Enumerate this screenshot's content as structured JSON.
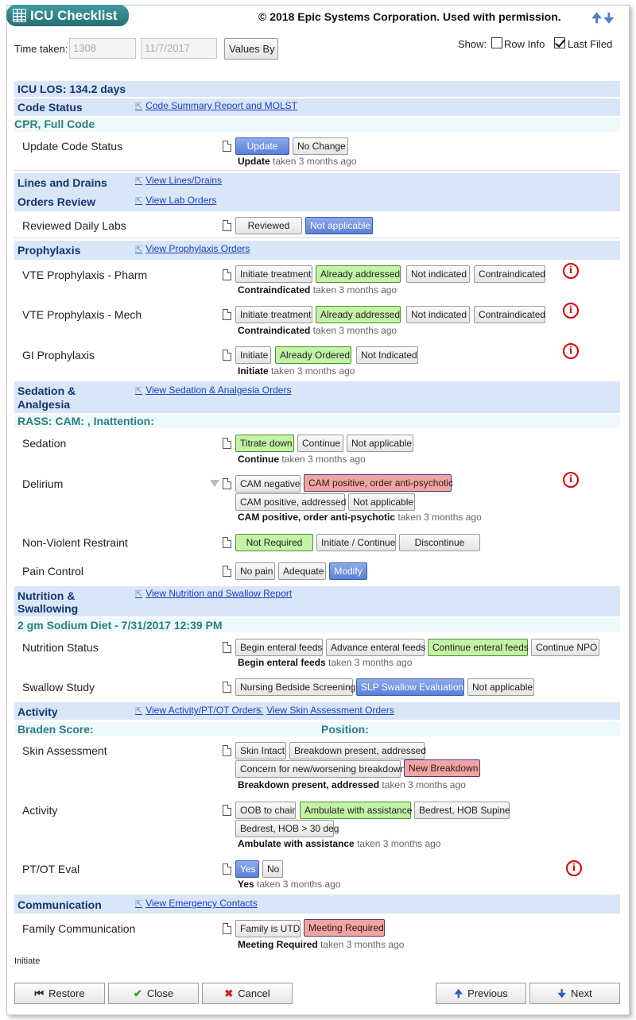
{
  "title": "ICU Checklist",
  "copyright": "© 2018 Epic Systems Corporation. Used with permission.",
  "header": {
    "time_taken_label": "Time taken:",
    "time": "1308",
    "date": "11/7/2017",
    "values_by": "Values By",
    "show_label": "Show:",
    "row_info": "Row Info",
    "last_filed": "Last Filed",
    "row_info_checked": false,
    "last_filed_checked": true
  },
  "los": "ICU LOS: 134.2 days",
  "code_status": {
    "title": "Code Status",
    "link": "Code Summary Report and MOLST",
    "sub": "CPR, Full Code",
    "row": {
      "label": "Update Code Status",
      "buttons": [
        "Update",
        "No Change"
      ],
      "note_bold": "Update",
      "note": "taken 3 months ago"
    }
  },
  "lines": {
    "title": "Lines and Drains",
    "link": "View Lines/Drains"
  },
  "orders": {
    "title": "Orders Review",
    "link": "View Lab Orders",
    "row": {
      "label": "Reviewed Daily Labs",
      "buttons": [
        "Reviewed",
        "Not applicable"
      ]
    }
  },
  "prophylaxis": {
    "title": "Prophylaxis",
    "link": "View Prophylaxis Orders",
    "vte_pharm": {
      "label": "VTE Prophylaxis - Pharm",
      "buttons": [
        "Initiate treatment",
        "Already addressed",
        "Not indicated",
        "Contraindicated"
      ],
      "note_bold": "Contraindicated",
      "note": "taken 3 months ago"
    },
    "vte_mech": {
      "label": "VTE Prophylaxis - Mech",
      "buttons": [
        "Initiate treatment",
        "Already addressed",
        "Not indicated",
        "Contraindicated"
      ],
      "note_bold": "Contraindicated",
      "note": "taken 3 months ago"
    },
    "gi": {
      "label": "GI Prophylaxis",
      "buttons": [
        "Initiate",
        "Already Ordered",
        "Not Indicated"
      ],
      "note_bold": "Initiate",
      "note": "taken 3 months ago"
    }
  },
  "sedation": {
    "title1": "Sedation &",
    "title2": "Analgesia",
    "link": "View Sedation & Analgesia Orders",
    "sub": "RASS:  CAM: , Inattention:",
    "sed": {
      "label": "Sedation",
      "buttons": [
        "Titrate down",
        "Continue",
        "Not applicable"
      ],
      "note_bold": "Continue",
      "note": "taken 3 months ago"
    },
    "delirium": {
      "label": "Delirium",
      "buttons": [
        "CAM negative",
        "CAM positive, order anti-psychotic",
        "CAM positive, addressed",
        "Not applicable"
      ],
      "note_bold": "CAM positive, order anti-psychotic",
      "note": "taken 3 months ago"
    },
    "restraint": {
      "label": "Non-Violent Restraint",
      "buttons": [
        "Not Required",
        "Initiate / Continue",
        "Discontinue"
      ]
    },
    "pain": {
      "label": "Pain Control",
      "buttons": [
        "No pain",
        "Adequate",
        "Modify"
      ]
    }
  },
  "nutrition": {
    "title1": "Nutrition &",
    "title2": "Swallowing",
    "link": "View Nutrition and Swallow Report",
    "sub": "2 gm Sodium Diet - 7/31/2017 12:39 PM",
    "status": {
      "label": "Nutrition Status",
      "buttons": [
        "Begin enteral feeds",
        "Advance enteral feeds",
        "Continue enteral feeds",
        "Continue NPO"
      ],
      "note_bold": "Begin enteral feeds",
      "note": "taken 3 months ago"
    },
    "swallow": {
      "label": "Swallow Study",
      "buttons": [
        "Nursing Bedside Screening",
        "SLP Swallow Evaluation",
        "Not applicable"
      ]
    }
  },
  "activity": {
    "title": "Activity",
    "link1": "View Activity/PT/OT Orders",
    "link2": "View Skin Assessment Orders",
    "braden": "Braden Score:",
    "position": "Position:",
    "skin": {
      "label": "Skin Assessment",
      "buttons": [
        "Skin Intact",
        "Breakdown present, addressed",
        "Concern for new/worsening breakdown",
        "New Breakdown"
      ],
      "note_bold": "Breakdown present, addressed",
      "note": "taken 3 months ago"
    },
    "act": {
      "label": "Activity",
      "buttons": [
        "OOB to chair",
        "Ambulate with assistance",
        "Bedrest, HOB Supine",
        "Bedrest, HOB > 30 deg"
      ],
      "note_bold": "Ambulate with assistance",
      "note": "taken 3 months ago"
    },
    "ptot": {
      "label": "PT/OT Eval",
      "buttons": [
        "Yes",
        "No"
      ],
      "note_bold": "Yes",
      "note": "taken 3 months ago"
    }
  },
  "communication": {
    "title": "Communication",
    "link": "View Emergency Contacts",
    "family": {
      "label": "Family Communication",
      "buttons": [
        "Family is UTD",
        "Meeting Required"
      ],
      "note_bold": "Meeting Required",
      "note": "taken 3 months ago"
    }
  },
  "footer_note": "Initiate",
  "footer": {
    "restore": "Restore",
    "close": "Close",
    "cancel": "Cancel",
    "previous": "Previous",
    "next": "Next"
  },
  "icons": {
    "warning": "i",
    "link_arrow": "⇱",
    "doc": "doc-icon"
  },
  "colors": {
    "band": "#d9e6f8",
    "selected_green": "#c3f3a6",
    "selected_blue": "#5c7fd7",
    "selected_red": "#f4a4a0",
    "title_teal": "#2d8489"
  }
}
